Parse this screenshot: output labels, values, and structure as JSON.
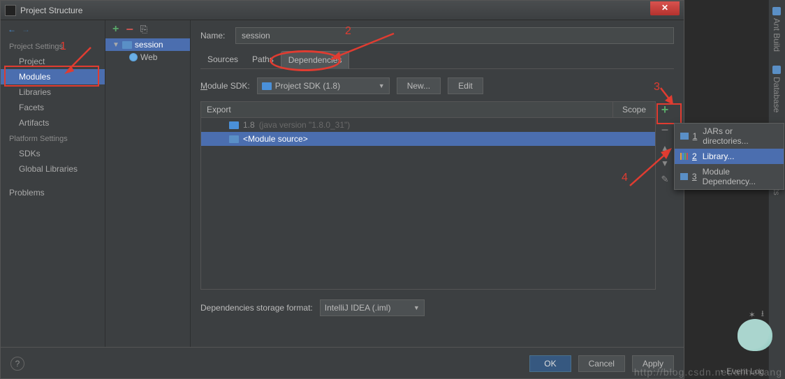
{
  "window": {
    "title": "Project Structure"
  },
  "sidebar": {
    "sections": {
      "project_settings": "Project Settings",
      "platform_settings": "Platform Settings"
    },
    "project": "Project",
    "modules": "Modules",
    "libraries": "Libraries",
    "facets": "Facets",
    "artifacts": "Artifacts",
    "sdks": "SDKs",
    "global_libraries": "Global Libraries",
    "problems": "Problems"
  },
  "tree": {
    "module": "session",
    "facet": "Web"
  },
  "main": {
    "name_label": "Name:",
    "name_value": "session",
    "tabs": {
      "sources": "Sources",
      "paths": "Paths",
      "dependencies": "Dependencies"
    },
    "sdk_label": "Module SDK:",
    "sdk_value": "Project SDK (1.8)",
    "new_btn": "New...",
    "edit_btn": "Edit",
    "dep_headers": {
      "export": "Export",
      "scope": "Scope"
    },
    "dep_rows": [
      {
        "label": "1.8",
        "dim": "(java version \"1.8.0_31\")"
      },
      {
        "label": "<Module source>"
      }
    ],
    "storage_label": "Dependencies storage format:",
    "storage_value": "IntelliJ IDEA (.iml)"
  },
  "popup": {
    "jars": "JARs or directories...",
    "library": "Library...",
    "module_dep": "Module Dependency..."
  },
  "footer": {
    "ok": "OK",
    "cancel": "Cancel",
    "apply": "Apply"
  },
  "gutter": {
    "ant": "Ant Build",
    "database": "Database",
    "maven": "Maven Projects"
  },
  "annotations": {
    "n1": "1",
    "n2": "2",
    "n3": "3",
    "n4": "4"
  },
  "misc": {
    "eventlog": "Event Log",
    "watermark": "http://blog.csdn.net/alinekang"
  }
}
